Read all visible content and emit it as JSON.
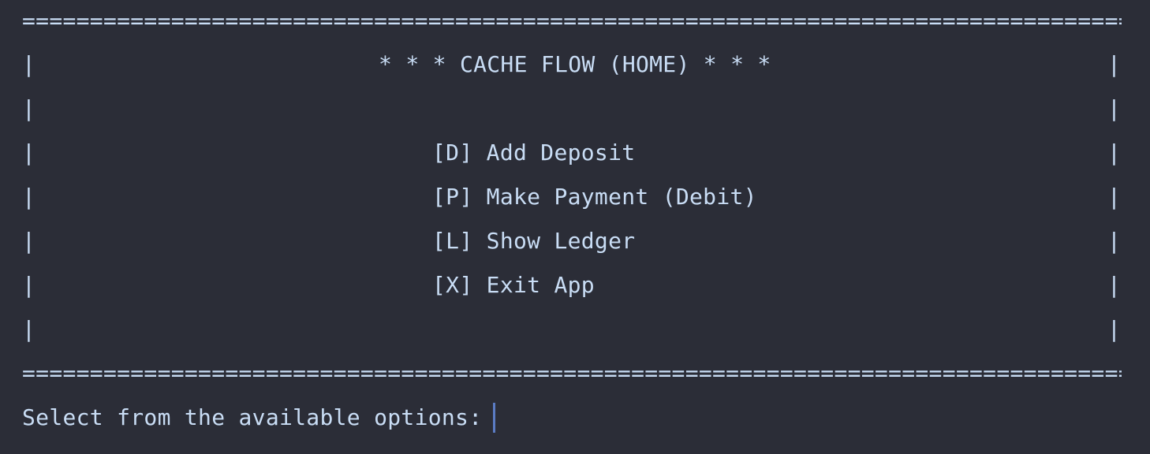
{
  "terminal": {
    "rule": "==================================================================================",
    "border_char": "|",
    "title": "* * * CACHE FLOW (HOME) * * *",
    "options": [
      {
        "key": "[D]",
        "label": "Add Deposit"
      },
      {
        "key": "[P]",
        "label": "Make Payment (Debit)"
      },
      {
        "key": "[L]",
        "label": "Show Ledger"
      },
      {
        "key": "[X]",
        "label": "Exit App"
      }
    ],
    "prompt": "Select from the available options:"
  },
  "colors": {
    "background": "#2b2d37",
    "text": "#c9ddf5",
    "cursor": "#5b7cc4"
  }
}
